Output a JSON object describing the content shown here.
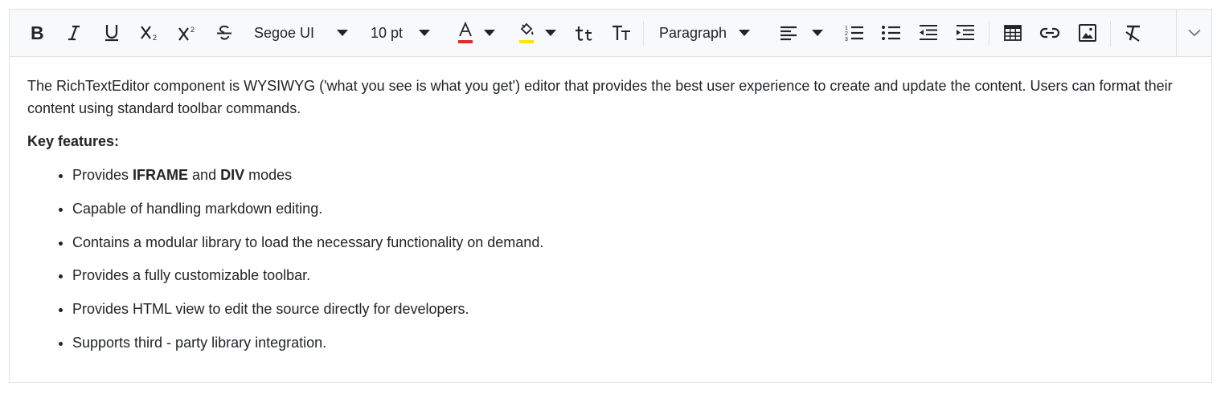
{
  "toolbar": {
    "font_name": "Segoe UI",
    "font_size": "10 pt",
    "format": "Paragraph",
    "font_color": "#e52929",
    "background_color": "#ffe500",
    "icons": {
      "bold": "bold-icon",
      "italic": "italic-icon",
      "underline": "underline-icon",
      "subscript": "subscript-icon",
      "superscript": "superscript-icon",
      "strikethrough": "strikethrough-icon",
      "lowercase": "lowercase-icon",
      "uppercase": "uppercase-icon",
      "align": "align-left-icon",
      "ordered_list": "ordered-list-icon",
      "unordered_list": "unordered-list-icon",
      "outdent": "outdent-icon",
      "indent": "indent-icon",
      "table": "table-icon",
      "link": "link-icon",
      "image": "image-icon",
      "clear_format": "clear-format-icon",
      "expand": "chevron-down-icon"
    }
  },
  "content": {
    "intro": "The RichTextEditor component is WYSIWYG ('what you see is what you get') editor that provides the best user experience to create and update the content. Users can format their content using standard toolbar commands.",
    "heading": "Key features:",
    "feature1": {
      "prefix": "Provides ",
      "bold1": "IFRAME",
      "middle": " and ",
      "bold2": "DIV",
      "suffix": " modes"
    },
    "features": [
      "Capable of handling markdown editing.",
      "Contains a modular library to load the necessary functionality on demand.",
      "Provides a fully customizable toolbar.",
      "Provides HTML view to edit the source directly for developers.",
      "Supports third - party library integration."
    ]
  }
}
